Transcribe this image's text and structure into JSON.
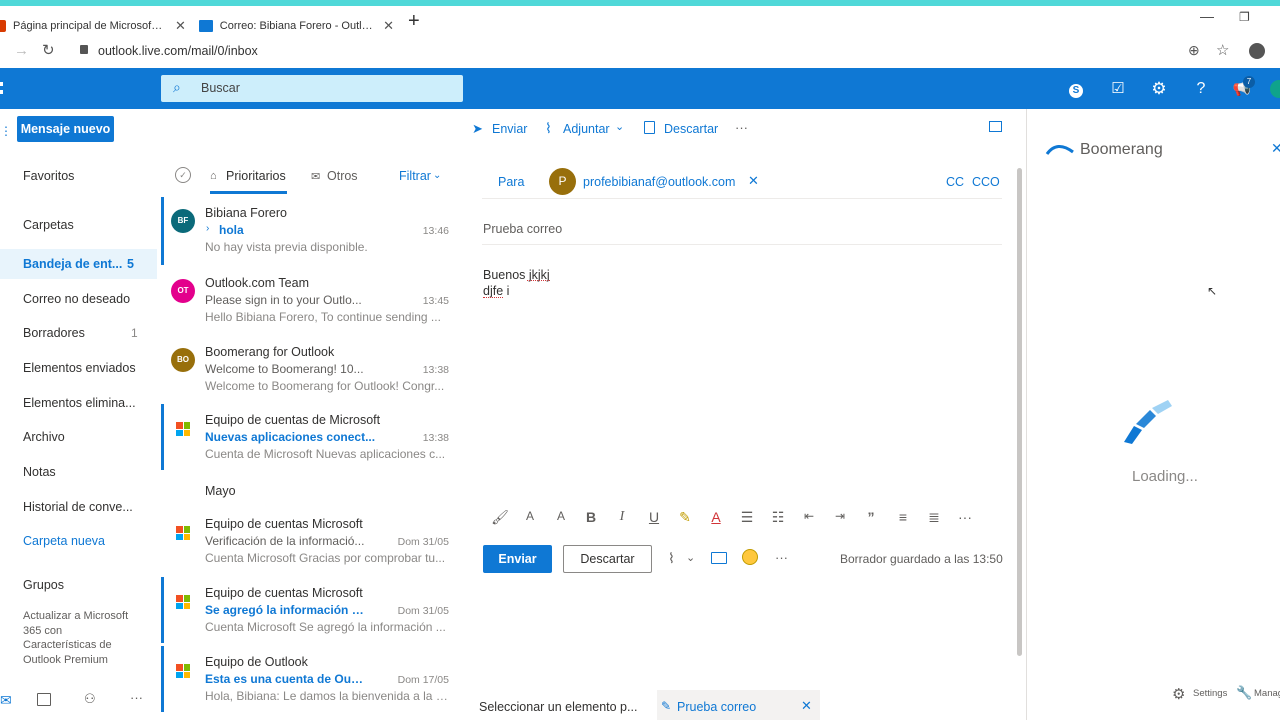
{
  "browser": {
    "tabs": [
      {
        "label": "Página principal de Microsoft Of"
      },
      {
        "label": "Correo: Bibiana Forero - Outlook"
      }
    ],
    "new_tab": "+",
    "url": "outlook.live.com/mail/0/inbox"
  },
  "header": {
    "search_placeholder": "Buscar",
    "badge": "7"
  },
  "nav": {
    "new_message": "Mensaje nuevo",
    "favorites": "Favoritos",
    "folders": "Carpetas",
    "items": [
      {
        "label": "Bandeja de ent...",
        "count": "5"
      },
      {
        "label": "Correo no deseado",
        "count": ""
      },
      {
        "label": "Borradores",
        "count": "1"
      },
      {
        "label": "Elementos enviados",
        "count": ""
      },
      {
        "label": "Elementos elimina...",
        "count": ""
      },
      {
        "label": "Archivo",
        "count": ""
      },
      {
        "label": "Notas",
        "count": ""
      },
      {
        "label": "Historial de conve...",
        "count": ""
      }
    ],
    "new_folder": "Carpeta nueva",
    "groups": "Grupos",
    "upgrade": "Actualizar a Microsoft 365 con Características de Outlook Premium"
  },
  "list": {
    "tab_focused": "Prioritarios",
    "tab_other": "Otros",
    "filter": "Filtrar",
    "section_may": "Mayo",
    "messages": [
      {
        "initials": "BF",
        "color": "#0b6a7a",
        "sender": "Bibiana Forero",
        "subject": "hola",
        "time": "13:46",
        "preview": "No hay vista previa disponible."
      },
      {
        "initials": "OT",
        "color": "#e3008c",
        "sender": "Outlook.com Team",
        "subject": "Please sign in to your Outlo...",
        "time": "13:45",
        "preview": "Hello Bibiana Forero, To continue sending ..."
      },
      {
        "initials": "BO",
        "color": "#986f0b",
        "sender": "Boomerang for Outlook",
        "subject": "Welcome to Boomerang! 10...",
        "time": "13:38",
        "preview": "Welcome to Boomerang for Outlook! Congr..."
      },
      {
        "initials": "",
        "color": "",
        "sender": "Equipo de cuentas de Microsoft",
        "subject": "Nuevas aplicaciones conect...",
        "time": "13:38",
        "preview": "Cuenta de Microsoft Nuevas aplicaciones c..."
      },
      {
        "initials": "",
        "color": "",
        "sender": "Equipo de cuentas Microsoft",
        "subject": "Verificación de la informació...",
        "time": "Dom 31/05",
        "preview": "Cuenta Microsoft Gracias por comprobar tu..."
      },
      {
        "initials": "",
        "color": "",
        "sender": "Equipo de cuentas Microsoft",
        "subject": "Se agregó la información d...",
        "time": "Dom 31/05",
        "preview": "Cuenta Microsoft Se agregó la información ..."
      },
      {
        "initials": "",
        "color": "",
        "sender": "Equipo de Outlook",
        "subject": "Esta es una cuenta de Outl...",
        "time": "Dom 17/05",
        "preview": "Hola, Bibiana: Le damos la bienvenida a la n..."
      }
    ]
  },
  "compose": {
    "send": "Enviar",
    "attach": "Adjuntar",
    "discard": "Descartar",
    "more": "···",
    "to_label": "Para",
    "recipient_initial": "P",
    "recipient": "profebibianaf@outlook.com",
    "cc": "CC",
    "bcc": "CCO",
    "subject": "Prueba correo",
    "body_line1": "Buenos jkjkj",
    "body_line2": "djfe i",
    "send_btn": "Enviar",
    "discard_btn": "Descartar",
    "draft_saved": "Borrador guardado a las 13:50"
  },
  "bottom": {
    "select_item": "Seleccionar un elemento p...",
    "draft_tab": "Prueba correo"
  },
  "boomerang": {
    "title": "Boomerang",
    "loading": "Loading...",
    "settings": "Settings",
    "manage": "Manag"
  }
}
